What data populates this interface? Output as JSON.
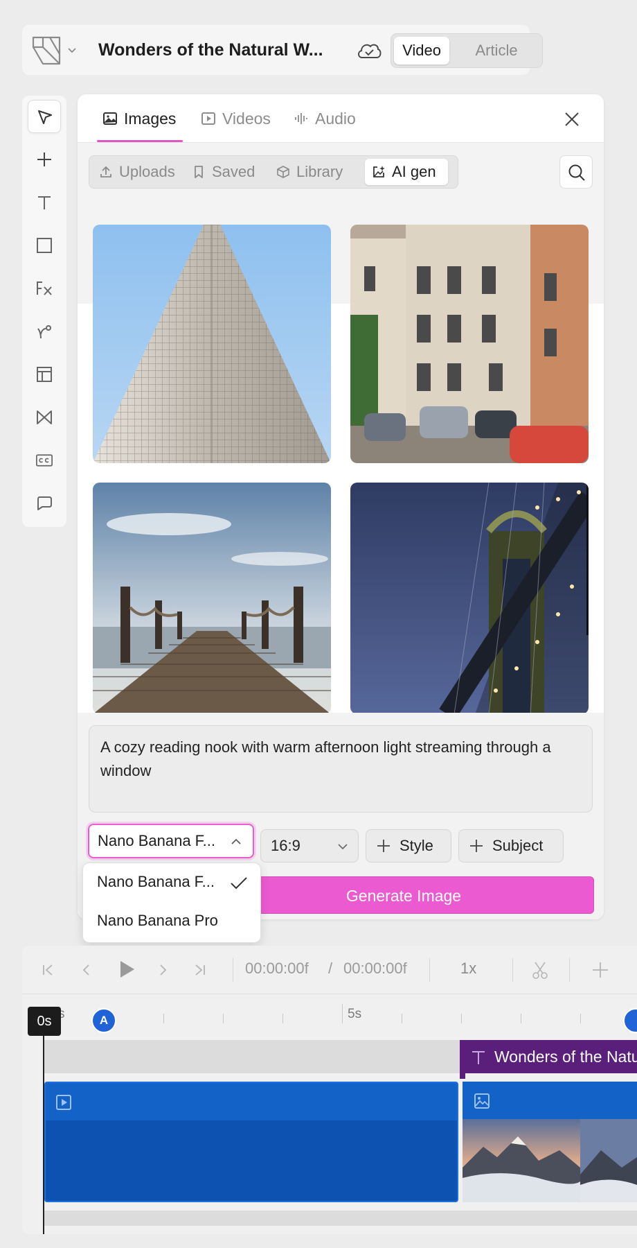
{
  "header": {
    "title": "Wonders of the Natural W...",
    "mode_options": [
      "Video",
      "Article"
    ],
    "mode_selected": "Video"
  },
  "panel": {
    "tabs": [
      {
        "label": "Images",
        "icon": "image-icon",
        "selected": true
      },
      {
        "label": "Videos",
        "icon": "play-square-icon",
        "selected": false
      },
      {
        "label": "Audio",
        "icon": "waveform-icon",
        "selected": false
      }
    ],
    "sources": [
      {
        "label": "Uploads",
        "icon": "upload-icon",
        "selected": false
      },
      {
        "label": "Saved",
        "icon": "bookmark-icon",
        "selected": false
      },
      {
        "label": "Library",
        "icon": "cube-icon",
        "selected": false
      },
      {
        "label": "AI gen",
        "icon": "sparkle-image-icon",
        "selected": true
      }
    ]
  },
  "generator": {
    "prompt": "A cozy reading nook with warm afternoon light streaming through a window",
    "model_value": "Nano Banana F...",
    "model_options": [
      {
        "label": "Nano Banana F...",
        "checked": true
      },
      {
        "label": "Nano Banana Pro",
        "checked": false
      }
    ],
    "aspect_ratio": "16:9",
    "style_label": "Style",
    "subject_label": "Subject",
    "generate_label": "Generate Image"
  },
  "timeline": {
    "current_time": "00:00:00f",
    "separator": "/",
    "total_time": "00:00:00f",
    "speed": "1x",
    "ruler_labels": [
      "s",
      "5s"
    ],
    "marker_label": "A",
    "playhead_label": "0s",
    "text_clip_label": "Wonders of the Natural World"
  },
  "colors": {
    "accent": "#eb5ad0",
    "clip_blue": "#0d52b0",
    "text_clip_purple": "#5a1f7a"
  }
}
